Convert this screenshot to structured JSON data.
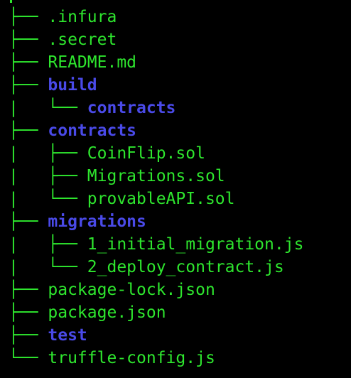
{
  "colors": {
    "background": "#000000",
    "file": "#2ee62e",
    "directory": "#4a4ae8"
  },
  "tree": [
    {
      "prefix": "├── ",
      "name": ".infura",
      "type": "file"
    },
    {
      "prefix": "├── ",
      "name": ".secret",
      "type": "file"
    },
    {
      "prefix": "├── ",
      "name": "README.md",
      "type": "file"
    },
    {
      "prefix": "├── ",
      "name": "build",
      "type": "dir"
    },
    {
      "prefix": "|   └── ",
      "name": "contracts",
      "type": "dir"
    },
    {
      "prefix": "├── ",
      "name": "contracts",
      "type": "dir"
    },
    {
      "prefix": "|   ├── ",
      "name": "CoinFlip.sol",
      "type": "file"
    },
    {
      "prefix": "|   ├── ",
      "name": "Migrations.sol",
      "type": "file"
    },
    {
      "prefix": "|   └── ",
      "name": "provableAPI.sol",
      "type": "file"
    },
    {
      "prefix": "├── ",
      "name": "migrations",
      "type": "dir"
    },
    {
      "prefix": "|   ├── ",
      "name": "1_initial_migration.js",
      "type": "file"
    },
    {
      "prefix": "|   └── ",
      "name": "2_deploy_contract.js",
      "type": "file"
    },
    {
      "prefix": "├── ",
      "name": "package-lock.json",
      "type": "file"
    },
    {
      "prefix": "├── ",
      "name": "package.json",
      "type": "file"
    },
    {
      "prefix": "├── ",
      "name": "test",
      "type": "dir"
    },
    {
      "prefix": "└── ",
      "name": "truffle-config.js",
      "type": "file"
    }
  ]
}
